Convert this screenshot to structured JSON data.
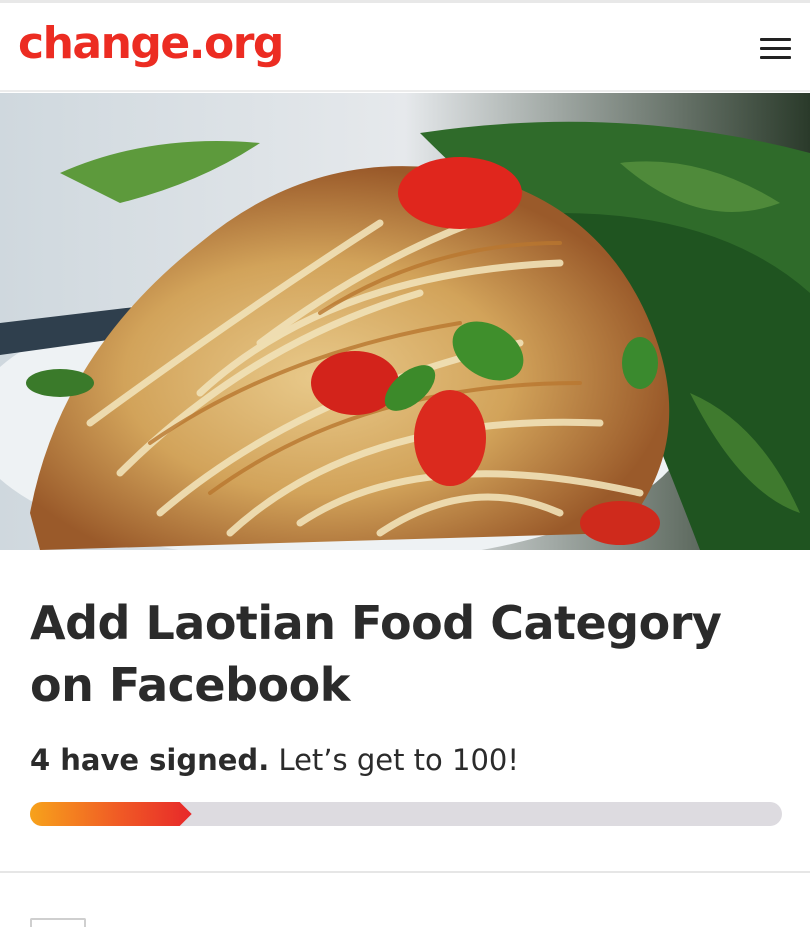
{
  "header": {
    "logo_text": "change.org",
    "brand_color": "#ec2c22",
    "menu_icon": "hamburger-menu-icon"
  },
  "hero": {
    "image_subject": "papaya salad"
  },
  "petition": {
    "title": "Add Laotian Food Category on Facebook",
    "signed_text": "4 have signed.",
    "goal_text": "Let’s get to 100!",
    "signatures": 4,
    "goal": 100,
    "progress_fraction": 0.215
  }
}
